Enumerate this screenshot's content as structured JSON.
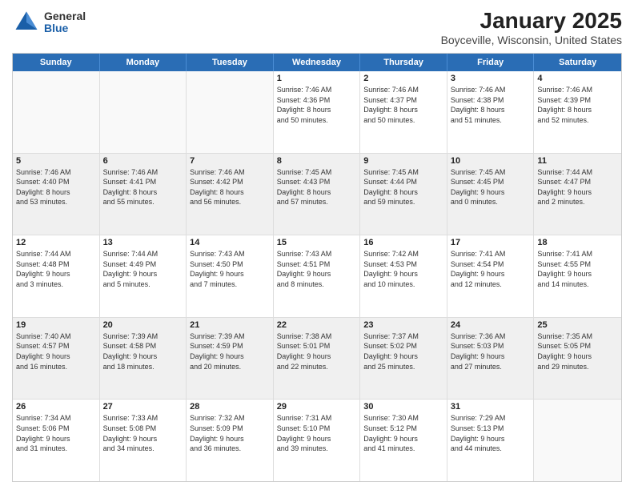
{
  "header": {
    "logo_general": "General",
    "logo_blue": "Blue",
    "title": "January 2025",
    "subtitle": "Boyceville, Wisconsin, United States"
  },
  "calendar": {
    "day_names": [
      "Sunday",
      "Monday",
      "Tuesday",
      "Wednesday",
      "Thursday",
      "Friday",
      "Saturday"
    ],
    "rows": [
      [
        {
          "date": "",
          "info": "",
          "empty": true
        },
        {
          "date": "",
          "info": "",
          "empty": true
        },
        {
          "date": "",
          "info": "",
          "empty": true
        },
        {
          "date": "1",
          "info": "Sunrise: 7:46 AM\nSunset: 4:36 PM\nDaylight: 8 hours\nand 50 minutes."
        },
        {
          "date": "2",
          "info": "Sunrise: 7:46 AM\nSunset: 4:37 PM\nDaylight: 8 hours\nand 50 minutes."
        },
        {
          "date": "3",
          "info": "Sunrise: 7:46 AM\nSunset: 4:38 PM\nDaylight: 8 hours\nand 51 minutes."
        },
        {
          "date": "4",
          "info": "Sunrise: 7:46 AM\nSunset: 4:39 PM\nDaylight: 8 hours\nand 52 minutes."
        }
      ],
      [
        {
          "date": "5",
          "info": "Sunrise: 7:46 AM\nSunset: 4:40 PM\nDaylight: 8 hours\nand 53 minutes."
        },
        {
          "date": "6",
          "info": "Sunrise: 7:46 AM\nSunset: 4:41 PM\nDaylight: 8 hours\nand 55 minutes."
        },
        {
          "date": "7",
          "info": "Sunrise: 7:46 AM\nSunset: 4:42 PM\nDaylight: 8 hours\nand 56 minutes."
        },
        {
          "date": "8",
          "info": "Sunrise: 7:45 AM\nSunset: 4:43 PM\nDaylight: 8 hours\nand 57 minutes."
        },
        {
          "date": "9",
          "info": "Sunrise: 7:45 AM\nSunset: 4:44 PM\nDaylight: 8 hours\nand 59 minutes."
        },
        {
          "date": "10",
          "info": "Sunrise: 7:45 AM\nSunset: 4:45 PM\nDaylight: 9 hours\nand 0 minutes."
        },
        {
          "date": "11",
          "info": "Sunrise: 7:44 AM\nSunset: 4:47 PM\nDaylight: 9 hours\nand 2 minutes."
        }
      ],
      [
        {
          "date": "12",
          "info": "Sunrise: 7:44 AM\nSunset: 4:48 PM\nDaylight: 9 hours\nand 3 minutes."
        },
        {
          "date": "13",
          "info": "Sunrise: 7:44 AM\nSunset: 4:49 PM\nDaylight: 9 hours\nand 5 minutes."
        },
        {
          "date": "14",
          "info": "Sunrise: 7:43 AM\nSunset: 4:50 PM\nDaylight: 9 hours\nand 7 minutes."
        },
        {
          "date": "15",
          "info": "Sunrise: 7:43 AM\nSunset: 4:51 PM\nDaylight: 9 hours\nand 8 minutes."
        },
        {
          "date": "16",
          "info": "Sunrise: 7:42 AM\nSunset: 4:53 PM\nDaylight: 9 hours\nand 10 minutes."
        },
        {
          "date": "17",
          "info": "Sunrise: 7:41 AM\nSunset: 4:54 PM\nDaylight: 9 hours\nand 12 minutes."
        },
        {
          "date": "18",
          "info": "Sunrise: 7:41 AM\nSunset: 4:55 PM\nDaylight: 9 hours\nand 14 minutes."
        }
      ],
      [
        {
          "date": "19",
          "info": "Sunrise: 7:40 AM\nSunset: 4:57 PM\nDaylight: 9 hours\nand 16 minutes."
        },
        {
          "date": "20",
          "info": "Sunrise: 7:39 AM\nSunset: 4:58 PM\nDaylight: 9 hours\nand 18 minutes."
        },
        {
          "date": "21",
          "info": "Sunrise: 7:39 AM\nSunset: 4:59 PM\nDaylight: 9 hours\nand 20 minutes."
        },
        {
          "date": "22",
          "info": "Sunrise: 7:38 AM\nSunset: 5:01 PM\nDaylight: 9 hours\nand 22 minutes."
        },
        {
          "date": "23",
          "info": "Sunrise: 7:37 AM\nSunset: 5:02 PM\nDaylight: 9 hours\nand 25 minutes."
        },
        {
          "date": "24",
          "info": "Sunrise: 7:36 AM\nSunset: 5:03 PM\nDaylight: 9 hours\nand 27 minutes."
        },
        {
          "date": "25",
          "info": "Sunrise: 7:35 AM\nSunset: 5:05 PM\nDaylight: 9 hours\nand 29 minutes."
        }
      ],
      [
        {
          "date": "26",
          "info": "Sunrise: 7:34 AM\nSunset: 5:06 PM\nDaylight: 9 hours\nand 31 minutes."
        },
        {
          "date": "27",
          "info": "Sunrise: 7:33 AM\nSunset: 5:08 PM\nDaylight: 9 hours\nand 34 minutes."
        },
        {
          "date": "28",
          "info": "Sunrise: 7:32 AM\nSunset: 5:09 PM\nDaylight: 9 hours\nand 36 minutes."
        },
        {
          "date": "29",
          "info": "Sunrise: 7:31 AM\nSunset: 5:10 PM\nDaylight: 9 hours\nand 39 minutes."
        },
        {
          "date": "30",
          "info": "Sunrise: 7:30 AM\nSunset: 5:12 PM\nDaylight: 9 hours\nand 41 minutes."
        },
        {
          "date": "31",
          "info": "Sunrise: 7:29 AM\nSunset: 5:13 PM\nDaylight: 9 hours\nand 44 minutes."
        },
        {
          "date": "",
          "info": "",
          "empty": true
        }
      ]
    ]
  }
}
